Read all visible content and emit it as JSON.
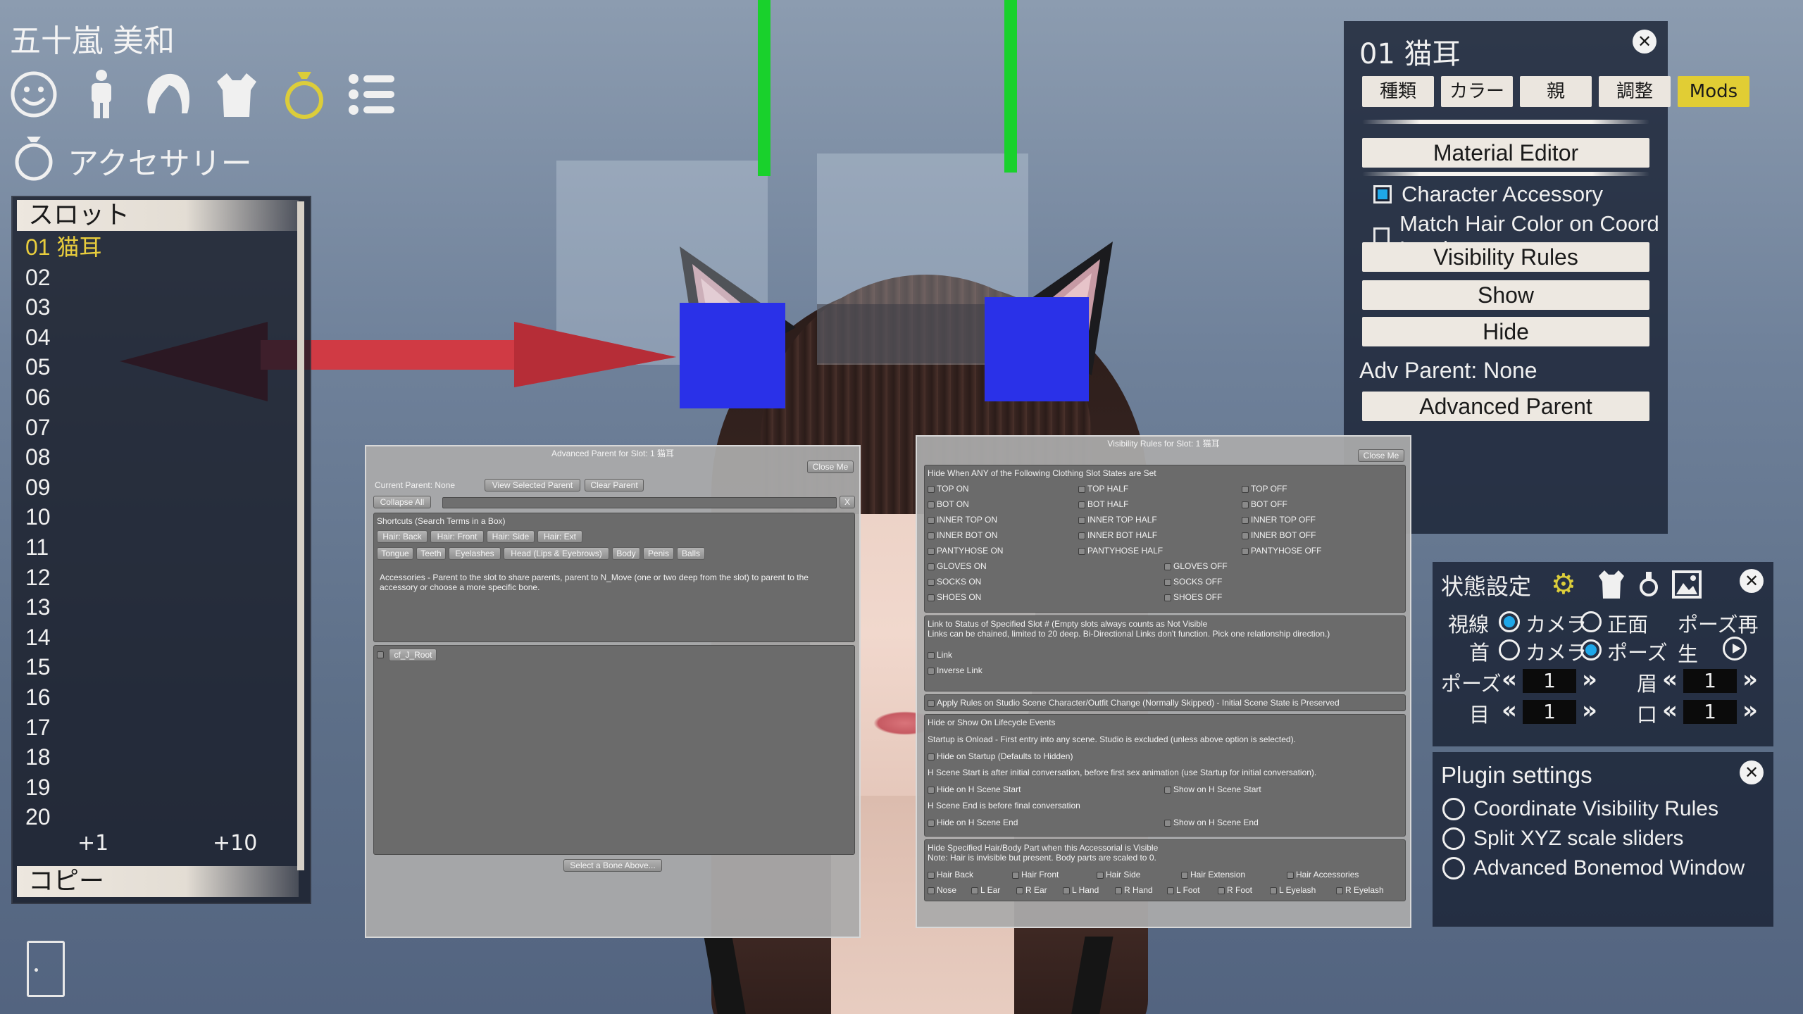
{
  "character_name": "五十嵐 美和",
  "category_icons": [
    "face-icon",
    "body-icon",
    "hair-icon",
    "clothing-icon",
    "accessory-icon",
    "list-icon"
  ],
  "section_title": "アクセサリー",
  "slots": {
    "header": "スロット",
    "items": [
      "01 猫耳",
      "02",
      "03",
      "04",
      "05",
      "06",
      "07",
      "08",
      "09",
      "10",
      "11",
      "12",
      "13",
      "14",
      "15",
      "16",
      "17",
      "18",
      "19",
      "20"
    ],
    "plus1": "+1",
    "plus10": "+10",
    "copy": "コピー"
  },
  "accessory_panel": {
    "title": "01 猫耳",
    "tabs": [
      "種類",
      "カラー",
      "親",
      "調整",
      "Mods"
    ],
    "active_tab": "Mods",
    "material_editor": "Material Editor",
    "character_accessory": "Character Accessory",
    "match_hair": "Match Hair Color on Coord Load",
    "visibility_rules": "Visibility Rules",
    "show": "Show",
    "hide": "Hide",
    "adv_parent_label": "Adv Parent: None",
    "advanced_parent": "Advanced Parent"
  },
  "status_panel": {
    "title": "状態設定",
    "gaze": "視線",
    "neck": "首",
    "camera": "カメラ",
    "front": "正面",
    "pose_play": "ポーズ再生",
    "pose": "ポーズ",
    "brow": "眉",
    "eye": "目",
    "mouth": "口",
    "pose_value": "1",
    "brow_value": "1",
    "eye_value": "1",
    "mouth_value": "1"
  },
  "plugin_panel": {
    "title": "Plugin settings",
    "options": [
      "Coordinate Visibility Rules",
      "Split XYZ scale sliders",
      "Advanced Bonemod Window"
    ]
  },
  "adv_parent_window": {
    "title": "Advanced Parent for Slot: 1 猫耳",
    "close": "Close Me",
    "current_parent": "Current Parent:  None",
    "view_selected": "View Selected Parent",
    "clear_parent": "Clear Parent",
    "collapse_all": "Collapse All",
    "clear_search": "X",
    "shortcuts_label": "Shortcuts (Search Terms in a Box)",
    "shortcuts_row1": [
      "Hair: Back",
      "Hair: Front",
      "Hair: Side",
      "Hair: Ext"
    ],
    "shortcuts_row2": [
      "Tongue",
      "Teeth",
      "Eyelashes",
      "Head (Lips & Eyebrows)",
      "Body",
      "Penis",
      "Balls"
    ],
    "accessories_note": "Accessories - Parent to the slot to share parents, parent to N_Move (one or two deep from the slot) to parent to the accessory or choose a more specific bone.",
    "root_node": "cf_J_Root",
    "select_bone": "Select a Bone Above..."
  },
  "visibility_window": {
    "title": "Visibility Rules for Slot: 1 猫耳",
    "close": "Close Me",
    "hide_when": "Hide When ANY of the Following Clothing Slot States are Set",
    "col1": [
      "TOP ON",
      "BOT ON",
      "INNER TOP ON",
      "INNER BOT ON",
      "PANTYHOSE ON",
      "GLOVES ON",
      "SOCKS ON",
      "SHOES ON"
    ],
    "col2": [
      "TOP HALF",
      "BOT HALF",
      "INNER TOP HALF",
      "INNER BOT HALF",
      "PANTYHOSE HALF"
    ],
    "col3": [
      "TOP OFF",
      "BOT OFF",
      "INNER TOP OFF",
      "INNER BOT OFF",
      "PANTYHOSE OFF"
    ],
    "col_off": [
      "GLOVES OFF",
      "SOCKS OFF",
      "SHOES OFF"
    ],
    "link_desc1": "Link to Status of Specified Slot # (Empty slots always counts as Not Visible",
    "link_desc2": "Links can be chained, limited to 20 deep. Bi-Directional Links don't function. Pick one relationship direction.)",
    "link": "Link",
    "inverse_link": "Inverse Link",
    "apply_rules": "Apply Rules on Studio Scene Character/Outfit Change (Normally Skipped) - Initial Scene State is Preserved",
    "lifecycle_title": "Hide or Show On Lifecycle Events",
    "startup_desc": "Startup is Onload - First entry into any scene. Studio is excluded (unless above option is selected).",
    "hide_on_startup": "Hide on Startup (Defaults to Hidden)",
    "hscene_start_desc": "H Scene Start is after initial conversation, before first sex animation (use Startup for initial conversation).",
    "hide_hscene_start": "Hide on H Scene Start",
    "show_hscene_start": "Show on H Scene Start",
    "hscene_end_desc": "H Scene End is before final conversation",
    "hide_hscene_end": "Hide on H Scene End",
    "show_hscene_end": "Show on H Scene End",
    "hide_parts_title": "Hide Specified Hair/Body Part when this Accessorial is Visible",
    "hide_parts_note": "Note: Hair is invisible but present. Body parts are scaled to 0.",
    "parts_row1": [
      "Hair Back",
      "Hair Front",
      "Hair Side",
      "Hair Extension",
      "Hair Accessories"
    ],
    "parts_row2": [
      "Nose",
      "L Ear",
      "R Ear",
      "L Hand",
      "R Hand",
      "L Foot",
      "R Foot",
      "L Eyelash",
      "R Eyelash"
    ]
  },
  "colors": {
    "accent_yellow": "#e1cd34",
    "active_slot": "#e8cd3d",
    "radio_blue": "#1ea7e8",
    "gizmo_green": "#19d12c",
    "gizmo_blue": "#2a31e8",
    "gizmo_red": "#d03a44"
  }
}
